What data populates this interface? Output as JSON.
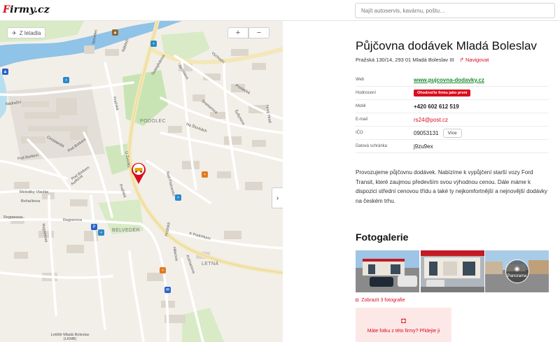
{
  "header": {
    "logo_text": "Firmy.cz",
    "logo_part_red": "F",
    "logo_part_dark": "irmy.cz",
    "search_placeholder": "Najít autoservis, kavárnu, poštu…"
  },
  "map": {
    "from_airport_label": "Z letadla",
    "zoom_in_label": "+",
    "zoom_out_label": "−",
    "collapse_icon": "chevron-right-icon",
    "labels": {
      "nadrazni": "Nádražní",
      "strmelec": "Strmelec",
      "prazska_1": "Pražská",
      "prazska_2": "Pražská",
      "prazska_3": "Pražská",
      "svatoplukova": "Svatoplukova",
      "nabrezi": "Nábřeží",
      "vychodni": "Východní",
      "jaroslava": "Jaroslava",
      "prosecka": "Prosecká",
      "novy_hrad": "Nový Hrad",
      "smetanova": "Smetanova",
      "podolec": "PODOLEC",
      "na_stuvkach": "Na Štuvkách",
      "sultysova": "Šultysova",
      "pod_borkem_1": "Pod Borkem",
      "pod_borkem_2": "Pod Borkem",
      "pod_borkem_3": "Pod Borkem",
      "chrastecka": "Chrástecká",
      "u_zvonku": "U Zvonku",
      "melodiky": "Melodiky Vlachie",
      "bonackova": "Boňačkova",
      "aurkova": "Aurkova",
      "nad_pisnici": "Nad Pískovnicí",
      "regnerova_1": "Regnerova",
      "regnerova_2": "Regnerova",
      "regnerova_3": "Regnerova",
      "belveder": "BELVEDÉR",
      "k_podchlumi": "K Podchlumí",
      "hilarova": "Hilarova",
      "kolmanova": "Kolmanova",
      "letna": "LETNÁ",
      "airport": "Letiště Mladá Boleslav (LKMB)"
    },
    "colors": {
      "pin": "#d90d1e",
      "water": "#8fc3e8",
      "park": "#c9e4b4"
    }
  },
  "company": {
    "name": "Půjčovna dodávek Mladá Boleslav",
    "address": "Pražská 130/14, 293 01 Mladá Boleslav III",
    "navigate_label": "Navigovat",
    "rows": [
      {
        "key": "Web",
        "value": "www.pujcovna-dodavky.cz"
      },
      {
        "key": "Hodnocení",
        "value": "Ohodnoťte firmu jako první"
      },
      {
        "key": "Mobil",
        "value": "+420 602 612 519"
      },
      {
        "key": "E-mail",
        "value": "rs24@post.cz"
      },
      {
        "key": "IČO",
        "value": "09053131",
        "more": "Více"
      },
      {
        "key": "Datová schránka",
        "value": "j9zu9ex"
      }
    ],
    "description": "Provozujeme půjčovnu dodávek. Nabízíme k vypůjčení starší vozy Ford Transit, které zaujmou především svou výhodnou cenou. Dále máme k dispozici střední cenovou třídu a také ty nejkomfortnější a nejnovější dodávky na českém trhu."
  },
  "gallery": {
    "title": "Fotogalerie",
    "panorama_label": "Panorama",
    "show_photos_label": "Zobrazit 3 fotografie",
    "add_photo_label": "Máte fotku z této firmy? Přidejte ji"
  },
  "accent_color": "#d90d1e",
  "link_color": "#1a8c2e"
}
